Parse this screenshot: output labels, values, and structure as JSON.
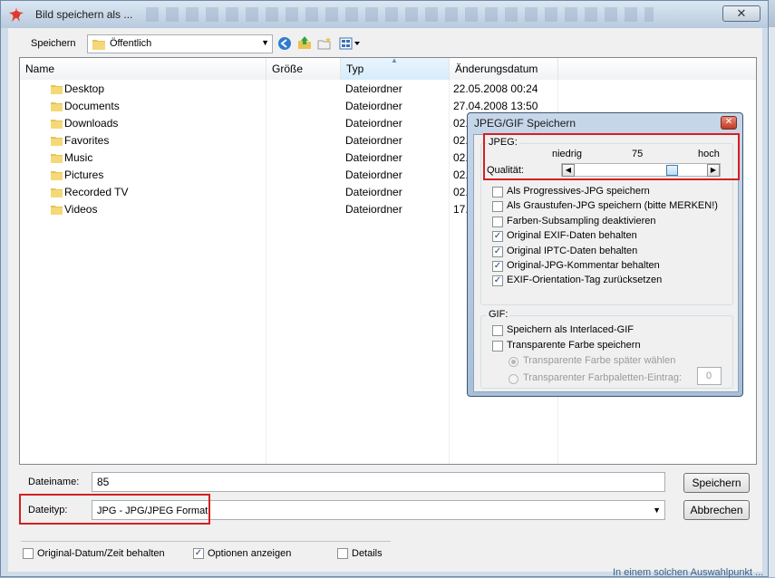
{
  "window": {
    "title": "Bild speichern als ..."
  },
  "background": {
    "bottom_text": "In einem solchen Auswahlpunkt ..."
  },
  "toolbar": {
    "save_in_label": "Speichern",
    "location": "Öffentlich",
    "icons": [
      "back-icon",
      "up-folder-icon",
      "new-folder-icon",
      "view-menu-icon"
    ]
  },
  "file_list": {
    "columns": [
      "Name",
      "Größe",
      "Typ",
      "Änderungsdatum"
    ],
    "rows": [
      {
        "name": "Desktop",
        "size": "",
        "type": "Dateiordner",
        "date": "22.05.2008 00:24"
      },
      {
        "name": "Documents",
        "size": "",
        "type": "Dateiordner",
        "date": "27.04.2008 13:50"
      },
      {
        "name": "Downloads",
        "size": "",
        "type": "Dateiordner",
        "date": "02."
      },
      {
        "name": "Favorites",
        "size": "",
        "type": "Dateiordner",
        "date": "02."
      },
      {
        "name": "Music",
        "size": "",
        "type": "Dateiordner",
        "date": "02."
      },
      {
        "name": "Pictures",
        "size": "",
        "type": "Dateiordner",
        "date": "02."
      },
      {
        "name": "Recorded TV",
        "size": "",
        "type": "Dateiordner",
        "date": "02."
      },
      {
        "name": "Videos",
        "size": "",
        "type": "Dateiordner",
        "date": "17."
      }
    ]
  },
  "bottom": {
    "filename_label": "Dateiname:",
    "filename_value": "85",
    "filetype_label": "Dateityp:",
    "filetype_value": "JPG - JPG/JPEG Format",
    "save_button": "Speichern",
    "cancel_button": "Abbrechen",
    "checkboxes": [
      {
        "label": "Original-Datum/Zeit behalten",
        "checked": false
      },
      {
        "label": "Optionen anzeigen",
        "checked": true
      },
      {
        "label": "Details",
        "checked": false
      }
    ]
  },
  "popup": {
    "title": "JPEG/GIF Speichern",
    "jpeg": {
      "group_label": "JPEG:",
      "low_label": "niedrig",
      "high_label": "hoch",
      "quality_label": "Qualität:",
      "quality_value": "75",
      "quality_fraction": 0.75,
      "options": [
        {
          "label": "Als Progressives-JPG speichern",
          "checked": false
        },
        {
          "label": "Als Graustufen-JPG speichern (bitte MERKEN!)",
          "checked": false
        },
        {
          "label": "Farben-Subsampling deaktivieren",
          "checked": false
        },
        {
          "label": "Original EXIF-Daten behalten",
          "checked": true
        },
        {
          "label": "Original IPTC-Daten behalten",
          "checked": true
        },
        {
          "label": "Original-JPG-Kommentar behalten",
          "checked": true
        },
        {
          "label": "EXIF-Orientation-Tag zurücksetzen",
          "checked": true
        }
      ]
    },
    "gif": {
      "group_label": "GIF:",
      "options": [
        {
          "label": "Speichern als Interlaced-GIF",
          "checked": false
        },
        {
          "label": "Transparente Farbe speichern",
          "checked": false
        }
      ],
      "radio_later": "Transparente Farbe später wählen",
      "radio_palette": "Transparenter Farbpaletten-Eintrag:",
      "palette_value": "0"
    }
  },
  "colors": {
    "highlight_red": "#d42020",
    "folder_yellow": "#e8c254"
  }
}
